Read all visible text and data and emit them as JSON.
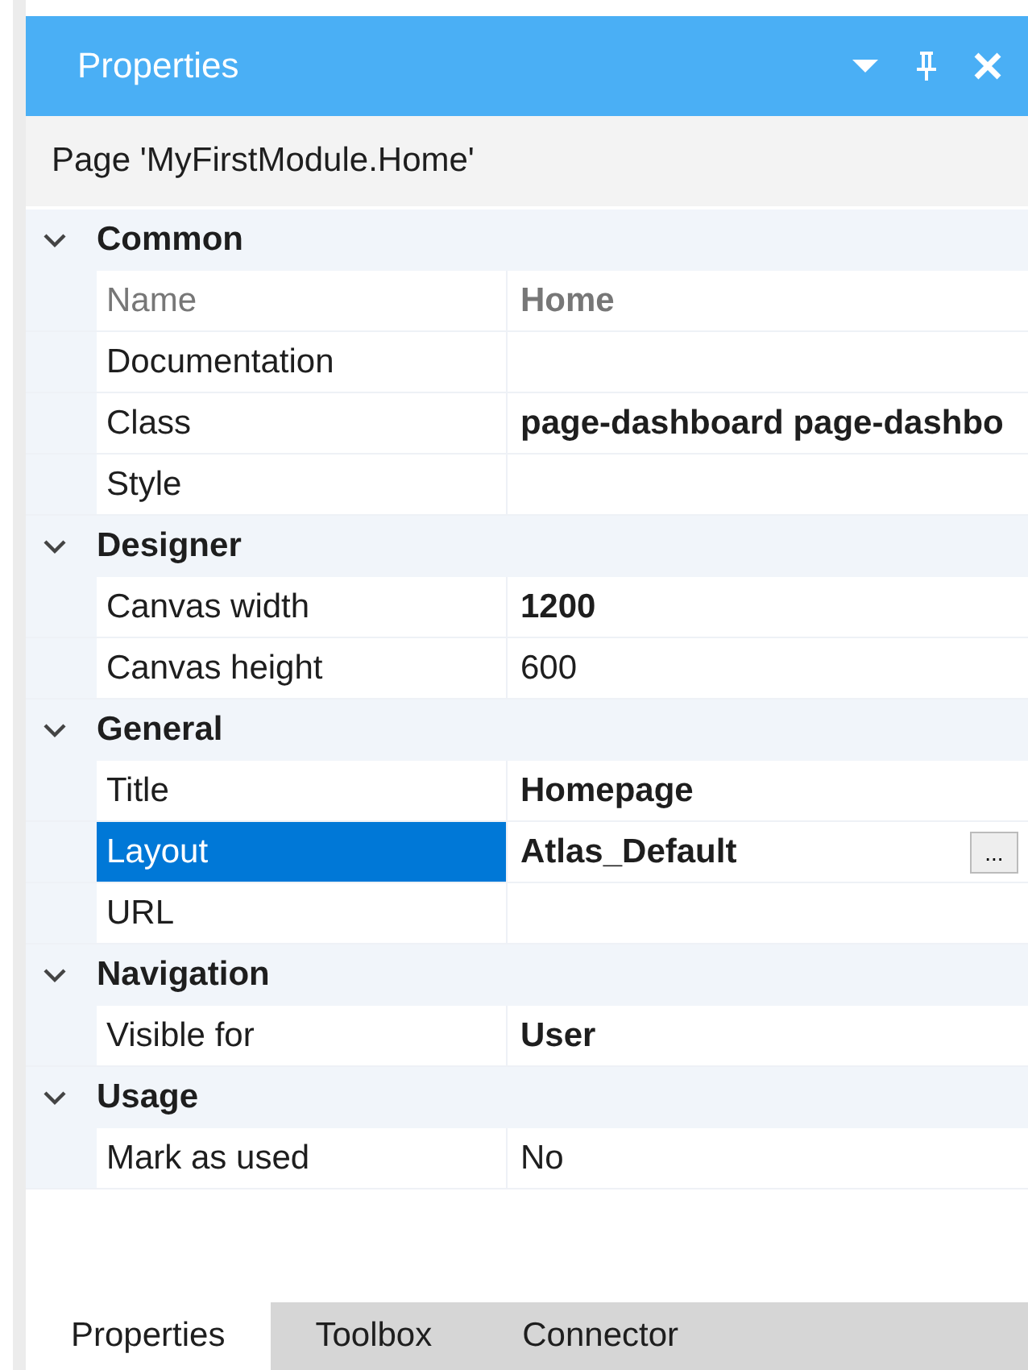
{
  "window": {
    "title": "Properties"
  },
  "subject": "Page 'MyFirstModule.Home'",
  "categories": [
    {
      "name": "Common",
      "expanded": true,
      "properties": [
        {
          "label": "Name",
          "value": "Home",
          "bold": true,
          "disabled": true,
          "selected": false
        },
        {
          "label": "Documentation",
          "disabled": false,
          "selected": false
        },
        {
          "label": "Class",
          "value": "page-dashboard page-dashbo",
          "bold": true,
          "disabled": false,
          "selected": false
        },
        {
          "label": "Style",
          "disabled": false,
          "selected": false
        }
      ]
    },
    {
      "name": "Designer",
      "expanded": true,
      "properties": [
        {
          "label": "Canvas width",
          "value": "1200",
          "bold": true,
          "disabled": false,
          "selected": false
        },
        {
          "label": "Canvas height",
          "value": "600",
          "bold": false,
          "disabled": false,
          "selected": false
        }
      ]
    },
    {
      "name": "General",
      "expanded": true,
      "properties": [
        {
          "label": "Title",
          "value": "Homepage",
          "bold": true,
          "disabled": false,
          "selected": false
        },
        {
          "label": "Layout",
          "value": "Atlas_Default",
          "bold": true,
          "disabled": false,
          "selected": true,
          "button": "..."
        },
        {
          "label": "URL",
          "disabled": false,
          "selected": false
        }
      ]
    },
    {
      "name": "Navigation",
      "expanded": true,
      "properties": [
        {
          "label": "Visible for",
          "value": "User",
          "bold": true,
          "disabled": false,
          "selected": false
        }
      ]
    },
    {
      "name": "Usage",
      "expanded": true,
      "properties": [
        {
          "label": "Mark as used",
          "value": "No",
          "bold": false,
          "disabled": false,
          "selected": false
        }
      ]
    }
  ],
  "tabs": [
    {
      "label": "Properties",
      "selected": true
    },
    {
      "label": "Toolbox",
      "selected": false
    },
    {
      "label": "Connector",
      "selected": false
    }
  ]
}
